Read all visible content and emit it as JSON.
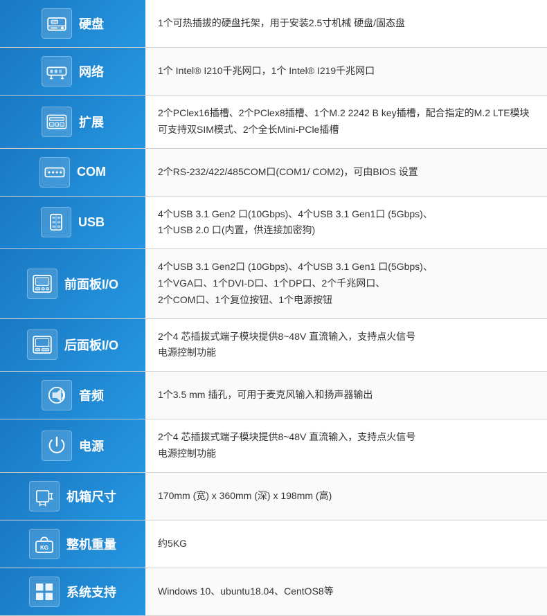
{
  "rows": [
    {
      "id": "hard-disk",
      "icon": "💿",
      "label": "硬盘",
      "value": "1个可热插拔的硬盘托架，用于安装2.5寸机械 硬盘/固态盘"
    },
    {
      "id": "network",
      "icon": "🔌",
      "label": "网络",
      "value": "1个 Intel® I210千兆网口，1个 Intel® I219千兆网口"
    },
    {
      "id": "expansion",
      "icon": "🖥",
      "label": "扩展",
      "value": "2个PClex16插槽、2个PClex8插槽、1个M.2 2242 B key插槽，配合指定的M.2 LTE模块可支持双SIM模式、2个全长Mini-PCle插槽"
    },
    {
      "id": "com",
      "icon": "⚙",
      "label": "COM",
      "value": "2个RS-232/422/485COM口(COM1/ COM2)，可由BIOS 设置"
    },
    {
      "id": "usb",
      "icon": "⬛",
      "label": "USB",
      "value": "4个USB 3.1 Gen2 口(10Gbps)、4个USB 3.1 Gen1口 (5Gbps)、\n1个USB 2.0 口(内置，供连接加密狗)"
    },
    {
      "id": "front-io",
      "icon": "🖨",
      "label": "前面板I/O",
      "value": "4个USB 3.1 Gen2口 (10Gbps)、4个USB 3.1 Gen1 口(5Gbps)、\n1个VGA口、1个DVI-D口、1个DP口、2个千兆网口、\n2个COM口、1个复位按钮、1个电源按钮"
    },
    {
      "id": "rear-io",
      "icon": "🖨",
      "label": "后面板I/O",
      "value": "2个4 芯插拔式端子模块提供8~48V 直流输入，支持点火信号\n电源控制功能"
    },
    {
      "id": "audio",
      "icon": "🔊",
      "label": "音频",
      "value": "1个3.5 mm 插孔，可用于麦克风输入和扬声器输出"
    },
    {
      "id": "power",
      "icon": "⚡",
      "label": "电源",
      "value": "2个4 芯插拔式端子模块提供8~48V 直流输入，支持点火信号\n电源控制功能"
    },
    {
      "id": "dimensions",
      "icon": "📐",
      "label": "机箱尺寸",
      "value": "170mm (宽) x 360mm (深) x 198mm (高)"
    },
    {
      "id": "weight",
      "icon": "🏷",
      "label": "整机重量",
      "value": "约5KG"
    },
    {
      "id": "os",
      "icon": "🪟",
      "label": "系统支持",
      "value": "Windows 10、ubuntu18.04、CentOS8等"
    }
  ],
  "icons": {
    "hard-disk": "hdd",
    "network": "network",
    "expansion": "expansion",
    "com": "com",
    "usb": "usb",
    "front-io": "front-io",
    "rear-io": "rear-io",
    "audio": "audio",
    "power": "power",
    "dimensions": "dimensions",
    "weight": "weight",
    "os": "os"
  }
}
